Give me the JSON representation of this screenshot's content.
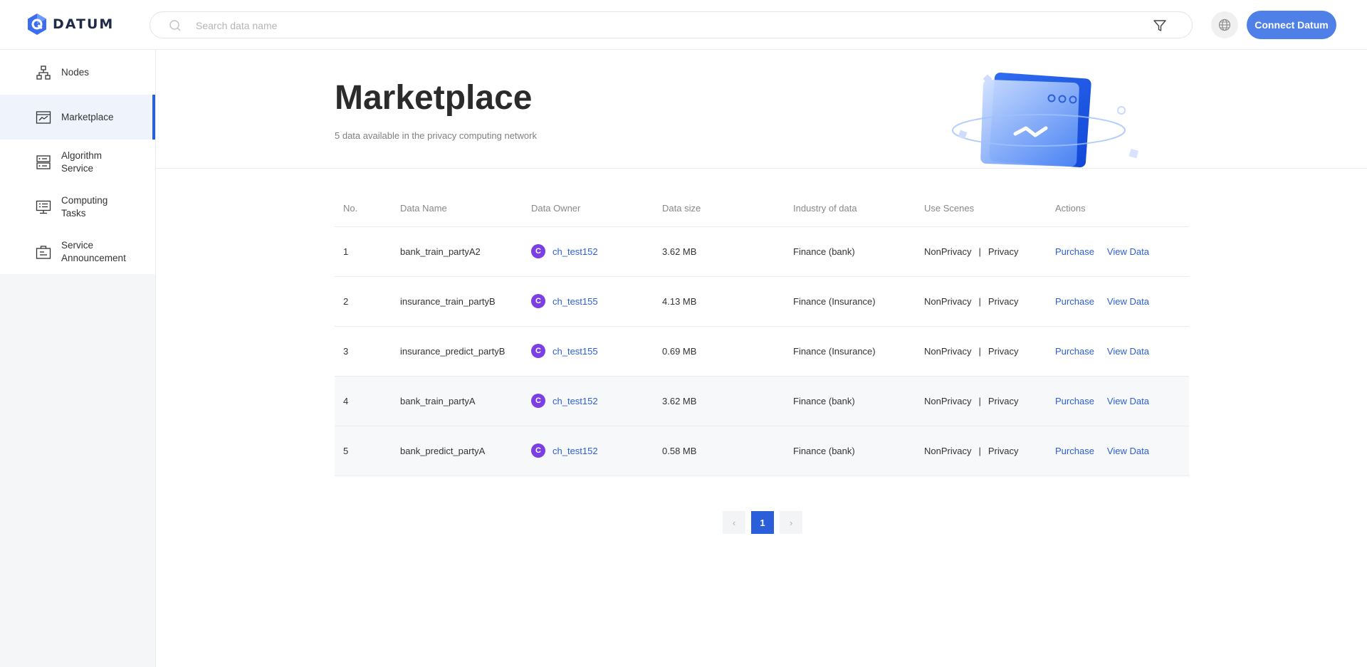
{
  "app": {
    "logo_text": "DATUM",
    "logo_icon": "datum-logo-icon"
  },
  "search": {
    "placeholder": "Search data name",
    "value": ""
  },
  "header": {
    "connect_label": "Connect Datum",
    "language_icon": "globe-icon",
    "filter_icon": "filter-icon"
  },
  "sidebar": {
    "items": [
      {
        "label": "Nodes",
        "icon": "nodes-icon",
        "active": false
      },
      {
        "label": "Marketplace",
        "icon": "marketplace-icon",
        "active": true
      },
      {
        "label": "Algorithm Service",
        "icon": "server-icon",
        "active": false
      },
      {
        "label": "Computing Tasks",
        "icon": "monitor-icon",
        "active": false
      },
      {
        "label": "Service Announcement",
        "icon": "briefcase-icon",
        "active": false
      }
    ]
  },
  "page": {
    "title": "Marketplace",
    "subtitle": "5 data available in the privacy computing network"
  },
  "table": {
    "columns": [
      "No.",
      "Data Name",
      "Data Owner",
      "Data size",
      "Industry of data",
      "Use Scenes",
      "Actions"
    ],
    "rows": [
      {
        "no": "1",
        "name": "bank_train_partyA2",
        "owner_initial": "C",
        "owner": "ch_test152",
        "size": "3.62 MB",
        "industry": "Finance (bank)",
        "scene_a": "NonPrivacy",
        "scene_sep": "|",
        "scene_b": "Privacy",
        "action_purchase": "Purchase",
        "action_view": "View Data"
      },
      {
        "no": "2",
        "name": "insurance_train_partyB",
        "owner_initial": "C",
        "owner": "ch_test155",
        "size": "4.13 MB",
        "industry": "Finance (Insurance)",
        "scene_a": "NonPrivacy",
        "scene_sep": "|",
        "scene_b": "Privacy",
        "action_purchase": "Purchase",
        "action_view": "View Data"
      },
      {
        "no": "3",
        "name": "insurance_predict_partyB",
        "owner_initial": "C",
        "owner": "ch_test155",
        "size": "0.69 MB",
        "industry": "Finance (Insurance)",
        "scene_a": "NonPrivacy",
        "scene_sep": "|",
        "scene_b": "Privacy",
        "action_purchase": "Purchase",
        "action_view": "View Data"
      },
      {
        "no": "4",
        "name": "bank_train_partyA",
        "owner_initial": "C",
        "owner": "ch_test152",
        "size": "3.62 MB",
        "industry": "Finance (bank)",
        "scene_a": "NonPrivacy",
        "scene_sep": "|",
        "scene_b": "Privacy",
        "action_purchase": "Purchase",
        "action_view": "View Data"
      },
      {
        "no": "5",
        "name": "bank_predict_partyA",
        "owner_initial": "C",
        "owner": "ch_test152",
        "size": "0.58 MB",
        "industry": "Finance (bank)",
        "scene_a": "NonPrivacy",
        "scene_sep": "|",
        "scene_b": "Privacy",
        "action_purchase": "Purchase",
        "action_view": "View Data"
      }
    ]
  },
  "pagination": {
    "prev": "‹",
    "current": "1",
    "next": "›"
  },
  "colors": {
    "accent": "#2b5ed9",
    "connect_button": "#4f80e8",
    "avatar": "#7b3fe4"
  }
}
